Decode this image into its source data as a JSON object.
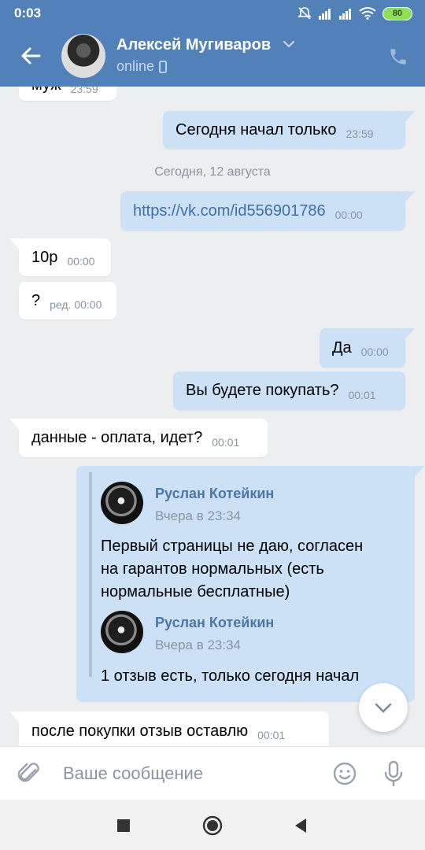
{
  "status_bar": {
    "time": "0:03",
    "battery": "80"
  },
  "toolbar": {
    "contact_name": "Алексей Мугиваров",
    "contact_status": "online"
  },
  "messages": [
    {
      "dir": "in",
      "text": "муж",
      "time": "23:59"
    },
    {
      "dir": "out",
      "text": "Сегодня начал только",
      "time": "23:59"
    },
    {
      "dir": "out",
      "text": "https://vk.com/id556901786",
      "time": "00:00"
    },
    {
      "dir": "in",
      "text": "10р",
      "time": "00:00"
    },
    {
      "dir": "in",
      "text": "?",
      "time": "ред. 00:00"
    },
    {
      "dir": "out",
      "text": "Да",
      "time": "00:00"
    },
    {
      "dir": "out",
      "text": "Вы будете покупать?",
      "time": "00:01"
    },
    {
      "dir": "in",
      "text": "данные - оплата, идет?",
      "time": "00:01"
    },
    {
      "dir": "in",
      "text": "после покупки отзыв оставлю",
      "time": "00:01"
    }
  ],
  "date_separator": "Сегодня, 12 августа",
  "forwarded": {
    "first": {
      "author": "Руслан Котейкин",
      "date": "Вчера в 23:34",
      "text_lines": [
        "Первый страницы не даю, согласен",
        "на гарантов нормальных (есть",
        "нормальные бесплатные)"
      ]
    },
    "second": {
      "author": "Руслан Котейкин",
      "date": "Вчера в 23:34",
      "text": "1 отзыв есть, только сегодня начал"
    }
  },
  "composer": {
    "placeholder": "Ваше сообщение"
  },
  "colors": {
    "header": "#5181b8",
    "out_bubble": "#cce0f6",
    "in_bubble": "#ffffff",
    "background": "#edeef0",
    "link": "#3f6fa8"
  },
  "icons": [
    "back-arrow-icon",
    "chevron-down-icon",
    "phone-icon",
    "mobile-icon",
    "paperclip-icon",
    "smile-icon",
    "microphone-icon",
    "scroll-down-chevron-icon",
    "nav-square-icon",
    "nav-circle-icon",
    "nav-triangle-icon"
  ]
}
